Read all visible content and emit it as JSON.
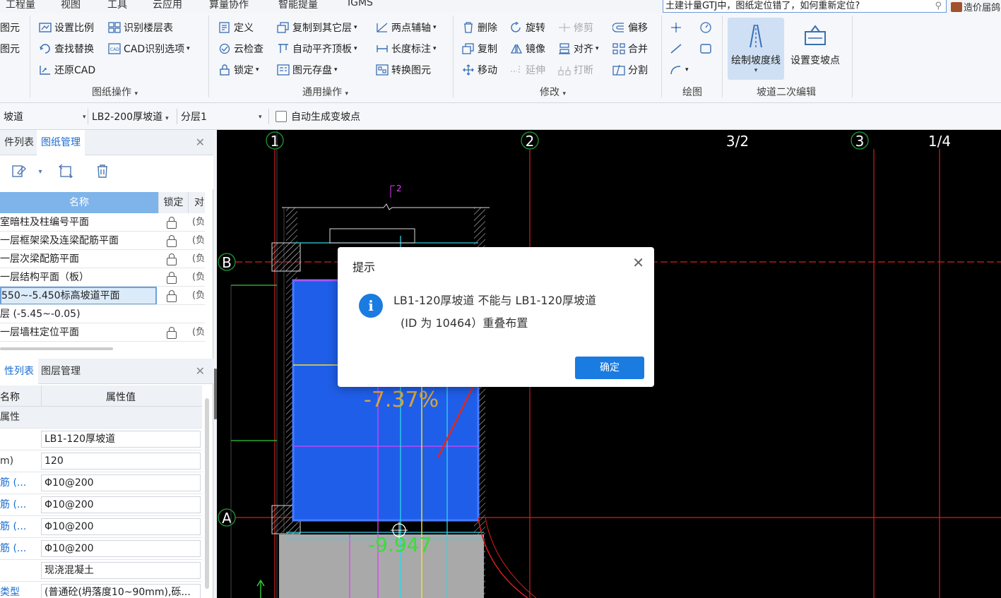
{
  "menu": [
    "工程量",
    "视图",
    "工具",
    "云应用",
    "算量协作",
    "智能提量",
    "IGMS"
  ],
  "search": {
    "value": "土建计量GTJ中，图纸定位错了，如何重新定位?"
  },
  "brand": "造价届鸽",
  "ribbon": {
    "cut_labels": [
      "图元",
      "图元"
    ],
    "drawing_ops": {
      "set_scale": "设置比例",
      "identify_floors": "识别楼层表",
      "find_replace": "查找替换",
      "cad_options": "CAD识别选项",
      "restore_cad": "还原CAD",
      "label": "图纸操作"
    },
    "general_ops": {
      "define": "定义",
      "copy_to_floor": "复制到其它层",
      "two_point_axis": "两点辅轴",
      "cloud_check": "云检查",
      "auto_flush": "自动平齐顶板",
      "length_dim": "长度标注",
      "lock": "锁定",
      "save_elements": "图元存盘",
      "convert": "转换图元",
      "label": "通用操作"
    },
    "modify": {
      "delete": "删除",
      "rotate": "旋转",
      "trim": "修剪",
      "offset": "偏移",
      "copy": "复制",
      "mirror": "镜像",
      "align": "对齐",
      "merge": "合并",
      "move": "移动",
      "extend": "延伸",
      "break": "打断",
      "split": "分割",
      "label": "修改"
    },
    "draw": {
      "label": "绘图"
    },
    "ramp_edit": {
      "draw_slope_line": "绘制坡度线",
      "set_change_point": "设置变坡点",
      "label": "坡道二次编辑"
    }
  },
  "proptool": {
    "type": "坡道",
    "component": "LB2-200厚坡道",
    "layer": "分层1",
    "auto_gen": "自动生成变坡点"
  },
  "left_panel": {
    "tabs_top": [
      "件列表",
      "图纸管理"
    ],
    "grid_headers": {
      "name": "名称",
      "lock": "锁定",
      "corr": "对"
    },
    "drawings": [
      {
        "name": "室暗柱及柱编号平面",
        "lock": true,
        "corr": "(负"
      },
      {
        "name": "一层框架梁及连梁配筋平面",
        "lock": true,
        "corr": "(负"
      },
      {
        "name": "一层次梁配筋平面",
        "lock": true,
        "corr": "(负"
      },
      {
        "name": "一层结构平面（板）",
        "lock": true,
        "corr": "(负"
      },
      {
        "name": "550~-5.450标高坡道平面",
        "lock": true,
        "corr": "(负",
        "selected": true
      },
      {
        "name": "层 (-5.45~-0.05)",
        "lock": false,
        "corr": ""
      },
      {
        "name": "一层墙柱定位平面",
        "lock": true,
        "corr": "(负"
      }
    ],
    "tabs_bottom": [
      "性列表",
      "图层管理"
    ],
    "prop_headers": {
      "name": "名称",
      "value": "属性值"
    },
    "props": [
      {
        "name": "属性",
        "value": "",
        "group": true
      },
      {
        "name": "",
        "value": "LB1-120厚坡道"
      },
      {
        "name": "m)",
        "value": "120"
      },
      {
        "name": "筋 (...",
        "value": "Φ10@200",
        "blue": true
      },
      {
        "name": "筋 (...",
        "value": "Φ10@200",
        "blue": true
      },
      {
        "name": "筋 (...",
        "value": "Φ10@200",
        "blue": true
      },
      {
        "name": "筋 (...",
        "value": "Φ10@200",
        "blue": true
      },
      {
        "name": "",
        "value": "现浇混凝土"
      },
      {
        "name": "类型",
        "value": "(普通砼(坍落度10~90mm),砾...",
        "blue": true
      }
    ]
  },
  "canvas": {
    "axis_top": [
      "1",
      "2",
      "3/2",
      "3",
      "1/4"
    ],
    "axis_left": [
      "B",
      "A"
    ],
    "slope_labels": [
      "-7.37%",
      "-9.947"
    ],
    "marker": "2"
  },
  "dialog": {
    "title": "提示",
    "line1": "LB1-120厚坡道 不能与 LB1-120厚坡道",
    "line2": "(ID 为 10464）重叠布置",
    "ok": "确定"
  },
  "colors": {
    "accent": "#1a7be0",
    "canvas_bg": "#000000",
    "ramp": "#1f5ee8"
  }
}
